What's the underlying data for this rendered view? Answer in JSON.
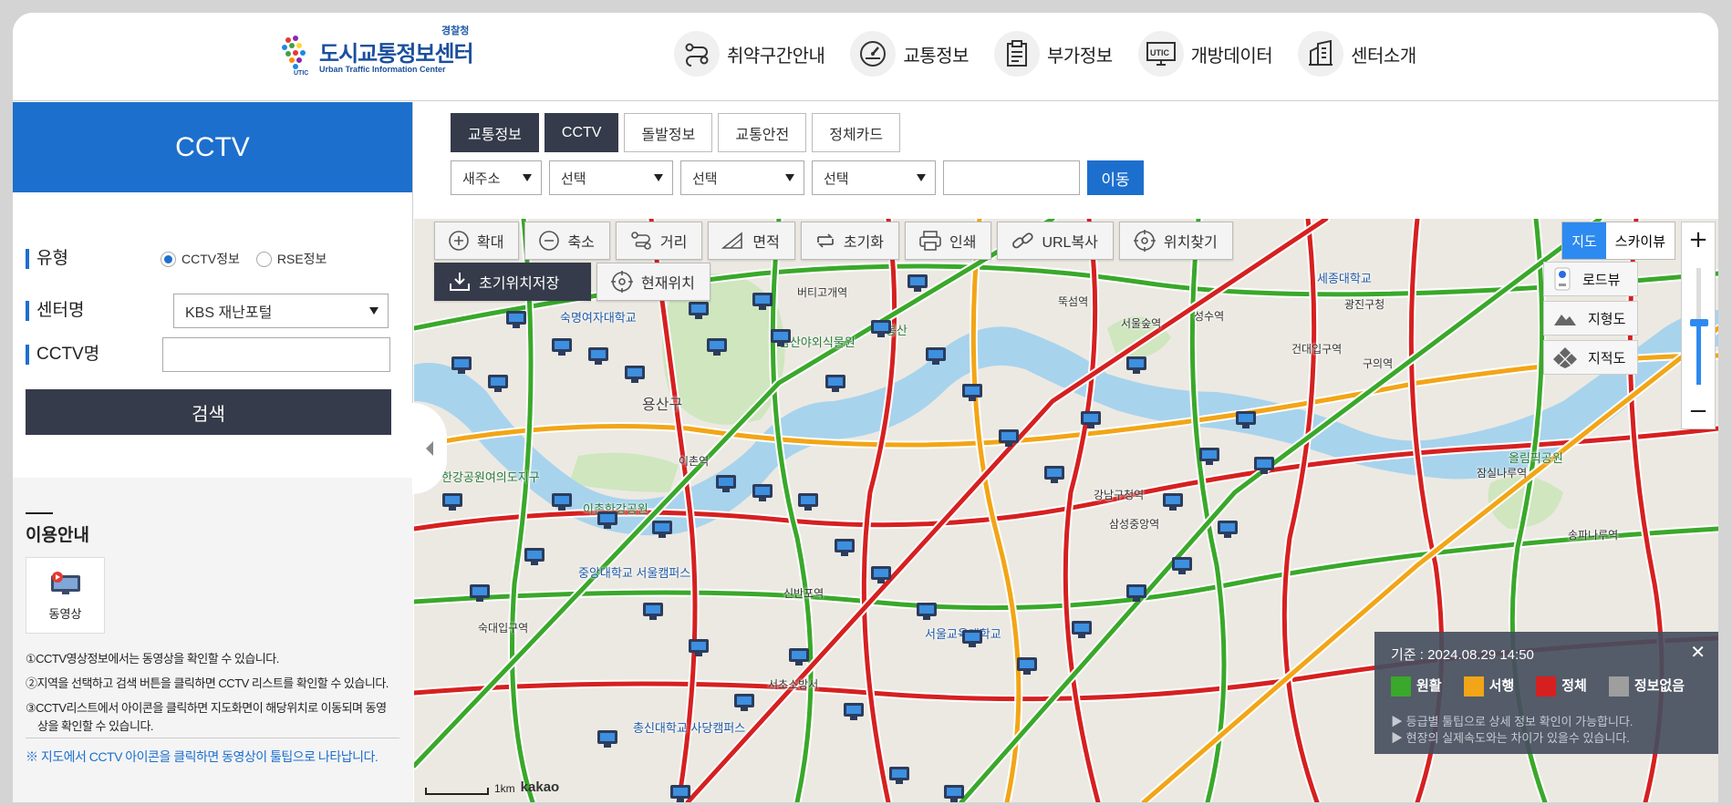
{
  "header": {
    "logo": {
      "org": "경찰청",
      "title": "도시교통정보센터",
      "subtitle": "Urban Traffic Information Center",
      "mark_text": "UTIC"
    },
    "nav": [
      {
        "label": "취약구간안내",
        "icon": "route-icon"
      },
      {
        "label": "교통정보",
        "icon": "speedometer-icon"
      },
      {
        "label": "부가정보",
        "icon": "clipboard-icon"
      },
      {
        "label": "개방데이터",
        "icon": "utic-monitor-icon"
      },
      {
        "label": "센터소개",
        "icon": "building-icon"
      }
    ]
  },
  "sidebar": {
    "title": "CCTV",
    "type_label": "유형",
    "type_options": [
      "CCTV정보",
      "RSE정보"
    ],
    "center_label": "센터명",
    "center_value": "KBS 재난포털",
    "cctv_name_label": "CCTV명",
    "cctv_name_value": "",
    "search_button": "검색",
    "guide": {
      "title": "이용안내",
      "video_label": "동영상",
      "lines": [
        "①CCTV영상정보에서는 동영상을 확인할 수 있습니다.",
        "②지역을 선택하고 검색 버튼을 클릭하면 CCTV 리스트를 확인할 수 있습니다.",
        "③CCTV리스트에서 아이콘을 클릭하면 지도화면이 해당위치로 이동되며 동영",
        "상을 확인할 수 있습니다."
      ],
      "note": "※ 지도에서 CCTV 아이콘을 클릭하면 동영상이 툴팁으로 나타납니다."
    }
  },
  "tabs": [
    "교통정보",
    "CCTV",
    "돌발정보",
    "교통안전",
    "정체카드"
  ],
  "filters": {
    "address_type": "새주소",
    "select1": "선택",
    "select2": "선택",
    "select3": "선택",
    "text_value": "",
    "move_button": "이동"
  },
  "map_tools": {
    "row1": [
      {
        "label": "확대",
        "icon": "zoom-in-icon"
      },
      {
        "label": "축소",
        "icon": "zoom-out-icon"
      },
      {
        "label": "거리",
        "icon": "distance-icon"
      },
      {
        "label": "면적",
        "icon": "area-icon"
      },
      {
        "label": "초기화",
        "icon": "reset-icon"
      },
      {
        "label": "인쇄",
        "icon": "print-icon"
      },
      {
        "label": "URL복사",
        "icon": "link-icon"
      },
      {
        "label": "위치찾기",
        "icon": "locate-icon"
      }
    ],
    "row2": [
      {
        "label": "초기위치저장",
        "icon": "download-icon"
      },
      {
        "label": "현재위치",
        "icon": "crosshair-icon"
      }
    ]
  },
  "map_type": {
    "map": "지도",
    "sky": "스카이뷰"
  },
  "map_layers": [
    "로드뷰",
    "지형도",
    "지적도"
  ],
  "legend": {
    "basis": "기준 : 2024.08.29 14:50",
    "items": [
      {
        "label": "원활",
        "color": "#3aa82a"
      },
      {
        "label": "서행",
        "color": "#f2a516"
      },
      {
        "label": "정체",
        "color": "#d62020"
      },
      {
        "label": "정보없음",
        "color": "#9e9e9e"
      }
    ],
    "hints": [
      "▶ 등급별 툴팁으로 상세 정보 확인이 가능합니다.",
      "▶ 현장의 실제속도와는 차이가 있을수 있습니다."
    ]
  },
  "scale": {
    "distance": "1km",
    "brand": "kakao"
  },
  "map_labels": [
    {
      "text": "용산구",
      "kind": "big"
    },
    {
      "text": "숙명여자대학교",
      "kind": "blue"
    },
    {
      "text": "남산야외식물원",
      "kind": "green"
    },
    {
      "text": "매봉산",
      "kind": "green"
    },
    {
      "text": "이촌역",
      "kind": "plain"
    },
    {
      "text": "이촌한강공원",
      "kind": "green"
    },
    {
      "text": "한강공원여의도지구",
      "kind": "green"
    },
    {
      "text": "세종대학교",
      "kind": "blue"
    },
    {
      "text": "서울숲역",
      "kind": "plain"
    },
    {
      "text": "성수역",
      "kind": "plain"
    },
    {
      "text": "건대입구역",
      "kind": "plain"
    },
    {
      "text": "강남구청역",
      "kind": "plain"
    },
    {
      "text": "삼성중앙역",
      "kind": "plain"
    },
    {
      "text": "중앙대학교 서울캠퍼스",
      "kind": "blue"
    },
    {
      "text": "서울교육대학교",
      "kind": "blue"
    },
    {
      "text": "총신대학교 사당캠퍼스",
      "kind": "blue"
    },
    {
      "text": "올림픽공원",
      "kind": "green"
    },
    {
      "text": "잠실나루역",
      "kind": "plain"
    },
    {
      "text": "송파나루역",
      "kind": "plain"
    },
    {
      "text": "신반포역",
      "kind": "plain"
    },
    {
      "text": "서초소방서",
      "kind": "plain"
    },
    {
      "text": "숙대입구역",
      "kind": "plain"
    },
    {
      "text": "버티고개역",
      "kind": "plain"
    },
    {
      "text": "뚝섬역",
      "kind": "plain"
    },
    {
      "text": "구의역",
      "kind": "plain"
    },
    {
      "text": "광진구청",
      "kind": "plain"
    }
  ],
  "colors": {
    "primary": "#1d6fcd",
    "dark": "#353b4a",
    "river": "#a8d3ec",
    "road_green": "#3aa82a",
    "road_red": "#d62020",
    "road_orange": "#f2a516"
  }
}
